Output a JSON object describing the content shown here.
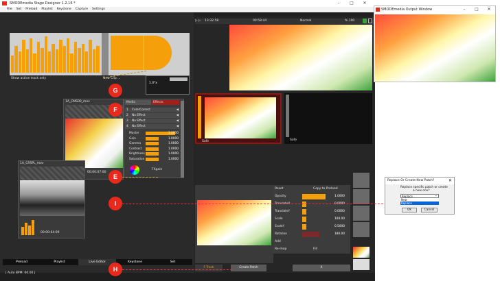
{
  "app": {
    "title": "SMODEmedia Stage Designer 1.2.16 *",
    "menu": [
      "File",
      "Set",
      "Preload",
      "Playlist",
      "Keystone",
      "Capture",
      "Settings"
    ]
  },
  "output_window": {
    "title": "SMODEmedia Output Window"
  },
  "top_left": {
    "bottom_left_label": "Show active track only",
    "bottom_right_label": "New Clip ..."
  },
  "zoom_popup": {
    "value": "1.0*x"
  },
  "clip1": {
    "name": "1A_CMS00_mov",
    "timecode": "00:00:07:00"
  },
  "clip2": {
    "name": "1A_CRSPL_mov",
    "timecode": "00:00:04:09"
  },
  "effects": {
    "tabs": [
      "Media",
      "Effects"
    ],
    "list": [
      "ColorCorrect",
      "No Effect",
      "No Effect",
      "No Effect"
    ],
    "params": [
      {
        "name": "Master",
        "value": "1.0000",
        "fill": 0.9
      },
      {
        "name": "Gain",
        "value": "1.0000",
        "fill": 0.4
      },
      {
        "name": "Gamma",
        "value": "1.0000",
        "fill": 0.4
      },
      {
        "name": "Contrast",
        "value": "1.0000",
        "fill": 0.4
      },
      {
        "name": "Brightness",
        "value": "1.0000",
        "fill": 0.4
      },
      {
        "name": "Saturation",
        "value": "1.0000",
        "fill": 0.4
      }
    ],
    "footer": "FXgain"
  },
  "preview_header": {
    "time_left": "13:32:58",
    "time_center": "00:58:44",
    "mode": "Normal",
    "zoom": "% 100"
  },
  "cue": {
    "left_label": "Safe",
    "right_label": "Safe"
  },
  "transform": {
    "headers": [
      "Reset",
      "Copy to Preload"
    ],
    "rows": [
      {
        "name": "Opacity",
        "value": "1.0000",
        "fill": 0.8
      },
      {
        "name": "TranslateX",
        "value": "0.0000",
        "fill": 0.15
      },
      {
        "name": "TranslateY",
        "value": "0.0000",
        "fill": 0.15
      },
      {
        "name": "Scale",
        "value": "100.00",
        "fill": 0.15
      },
      {
        "name": "ScaleY",
        "value": "0.5000",
        "fill": 0.15
      },
      {
        "name": "Rotation",
        "value": "180.00",
        "fill": 0.6
      }
    ],
    "add_label": "Add",
    "remap_label": "Re-map",
    "remap_value": "Fill",
    "bottom_button": "X"
  },
  "bottom_tabs": [
    "Preload",
    "Playlist",
    "Live Editor",
    "Keystone",
    "Set"
  ],
  "status": {
    "bpm": "| Auto BPM: 60.00 |"
  },
  "bottom_buttons": {
    "track": "F Track",
    "create_patch": "Create Patch"
  },
  "markers": [
    "G",
    "F",
    "E",
    "I",
    "H"
  ],
  "dialog": {
    "title": "Replace Or Create New Patch?",
    "message_line1": "Replace specific patch or create",
    "message_line2": "a new one?",
    "selected": "Replace",
    "options": [
      "New",
      "Replace"
    ],
    "ok": "OK",
    "cancel": "Cancel"
  },
  "colors": {
    "accent": "#f5a00a",
    "marker": "#e8291c",
    "panel": "#2d2d2d"
  }
}
